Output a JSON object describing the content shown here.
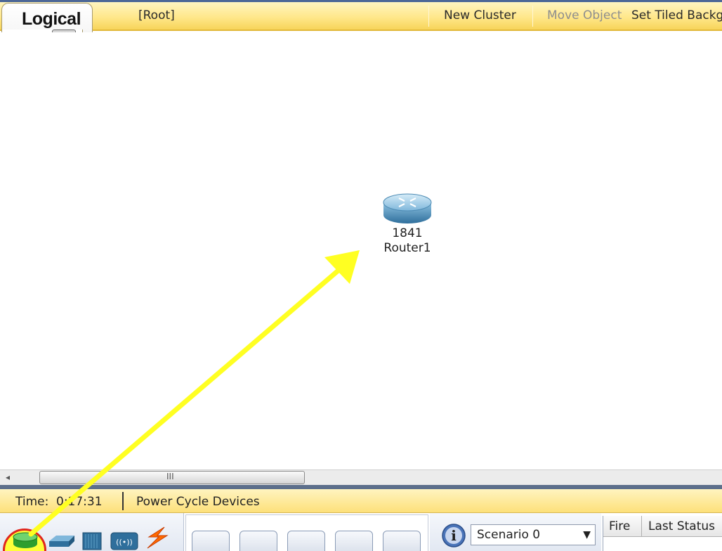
{
  "toolbar": {
    "tab_title": "Logical",
    "root_label": "[Root]",
    "new_cluster": "New Cluster",
    "move_object": "Move Object",
    "set_tiled_background": "Set Tiled Backg"
  },
  "workspace": {
    "device": {
      "model": "1841",
      "name": "Router1",
      "icon": "router-icon"
    }
  },
  "scrollbar": {
    "left_arrow": "◂",
    "grip": "III"
  },
  "status_bar": {
    "time_label": "Time:",
    "time_value": "0:17:31",
    "power_cycle": "Power Cycle Devices"
  },
  "device_categories": [
    {
      "name": "routers-icon"
    },
    {
      "name": "switches-icon"
    },
    {
      "name": "hubs-icon"
    },
    {
      "name": "wireless-devices-icon"
    },
    {
      "name": "connections-icon"
    }
  ],
  "scenario": {
    "selected": "Scenario 0",
    "arrow": "▼"
  },
  "pdu_table": {
    "col_fire": "Fire",
    "col_last_status": "Last Status"
  },
  "colors": {
    "toolbar": "#ffe789",
    "annotation_arrow": "#ffff22",
    "highlight_ring": "#e0271d",
    "router_blue": "#5fa0c8"
  }
}
